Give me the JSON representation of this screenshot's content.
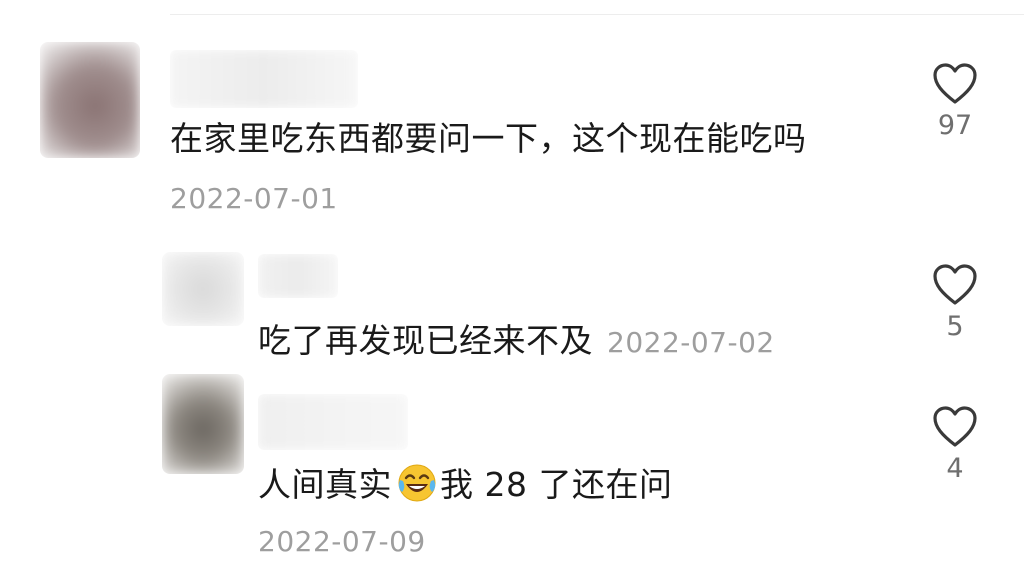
{
  "comments": [
    {
      "text": "在家里吃东西都要问一下，这个现在能吃吗",
      "date": "2022-07-01",
      "likes": "97",
      "avatar_color": "#8a7373"
    },
    {
      "text": "吃了再发现已经来不及",
      "date": "2022-07-02",
      "likes": "5",
      "avatar_color": "#d9d9d9"
    },
    {
      "text_before_emoji": "人间真实",
      "emoji_icon": "face-with-tears-of-joy-icon",
      "text_after_emoji": "我 28 了还在问",
      "date": "2022-07-09",
      "likes": "4",
      "avatar_color": "#6b6660"
    }
  ],
  "colors": {
    "text": "#1a1a1a",
    "date": "#9e9e9e",
    "like_count": "#6f6f6f",
    "heart_stroke": "#3a3a3a"
  }
}
